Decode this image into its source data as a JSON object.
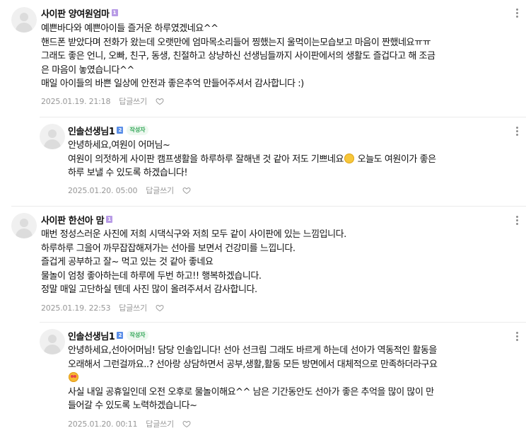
{
  "comments": [
    {
      "author": "사이판 양여원엄마",
      "level": "1",
      "text": "예쁜바다와 예쁜아이들 즐거운 하루였겠네요^^\n핸드폰 받았다며 전화가 왔는데 오랫만에 엄마목소리들어 찡했는지 울먹이는모습보고 마음이 짠했네요ㅠㅠ\n그래도 좋은 언니, 오빠, 친구, 동생, 친절하고 상냥하신 선생님들까지 사이판에서의 생활도 즐겁다고 해 조금\n은 마음이 놓였습니다^^\n매일 아이들의 바쁜 일상에 안전과 좋은추억 만들어주셔서 감사합니다 :)",
      "date": "2025.01.19. 21:18",
      "reply_label": "답글쓰기"
    },
    {
      "author": "인솔선생님1",
      "level": "2",
      "badge": "작성자",
      "text_before_emoji": "안녕하세요,여원이 어머님~\n여원이 의젓하게 사이판 캠프생활을 하루하루 잘해낸 것 같아 저도 기쁘네요",
      "emoji": "smiling-face",
      "text_after_emoji": " 오늘도 여원이가 좋은\n하루 보낼 수 있도록 하겠습니다!",
      "date": "2025.01.20. 05:00",
      "reply_label": "답글쓰기"
    },
    {
      "author": "사이판 한선아 맘",
      "level": "1",
      "text": "매번 정성스러운 사진에 저희 시댁식구와 저희 모두 같이 사이판에 있는 느낌입니다.\n하루하루 그을어 까무잡잡해져가는 선아를 보면서 건강미를 느낍니다.\n즐겁게 공부하고 잘~ 먹고 있는 것 같아 좋네요\n물놀이 엄청 좋아하는데 하루에 두번 하고!! 행복하겠습니다.\n정말 매일 고단하실 텐데 사진 많이 올려주셔서 감사합니다.",
      "date": "2025.01.19. 22:53",
      "reply_label": "답글쓰기"
    },
    {
      "author": "인솔선생님1",
      "level": "2",
      "badge": "작성자",
      "text_before_emoji": "안녕하세요,선아어머님! 담당 인솔입니다! 선아 선크림 그래도 바르게 하는데 선아가 역동적인 활동을\n오래해서 그런걸까요..? 선아랑 상담하면서 공부,생활,활동 모든 방면에서 대체적으로 만족하더라구요\n",
      "emoji": "smiling-face-with-hearts",
      "text_after_emoji": "\n사실 내일 공휴일인데 오전 오후로 물놀이해요^^ 남은 기간동안도 선아가 좋은 추억을 많이 많이 만\n들어갈 수 있도록 노력하겠습니다~",
      "date": "2025.01.20. 00:11",
      "reply_label": "답글쓰기"
    }
  ]
}
